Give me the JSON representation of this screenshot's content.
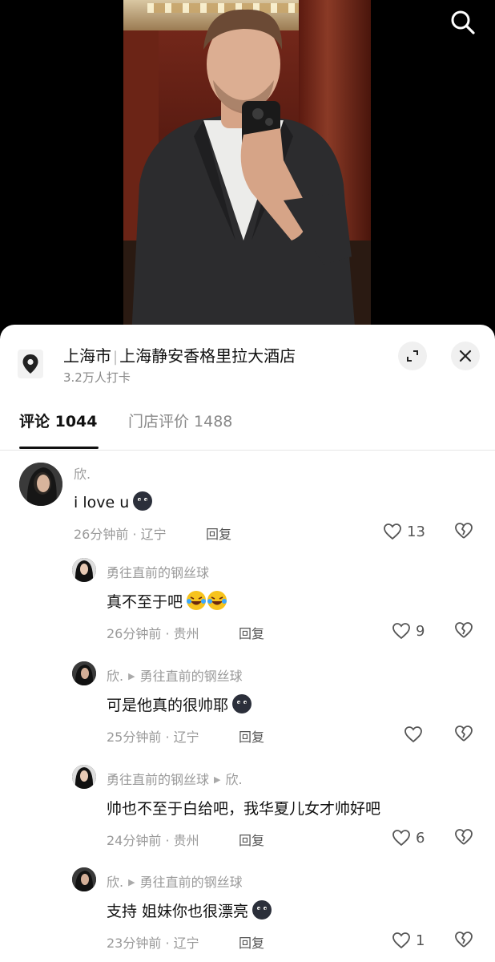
{
  "location": {
    "city": "上海市",
    "separator": "|",
    "place": "上海静安香格里拉大酒店",
    "checkins": "3.2万人打卡"
  },
  "tabs": [
    {
      "label": "评论 1044",
      "active": true
    },
    {
      "label": "门店评价 1488",
      "active": false
    }
  ],
  "comments": [
    {
      "user": "欣.",
      "text": "i love u",
      "time": "26分钟前 · 辽宁",
      "reply": "回复",
      "likes": "13"
    },
    {
      "user": "勇往直前的钢丝球",
      "text": "真不至于吧",
      "time": "26分钟前 · 贵州",
      "reply": "回复",
      "likes": "9"
    },
    {
      "user": "欣.",
      "reply_to": "勇往直前的钢丝球",
      "text": "可是他真的很帅耶",
      "time": "25分钟前 · 辽宁",
      "reply": "回复",
      "likes": ""
    },
    {
      "user": "勇往直前的钢丝球",
      "reply_to": "欣.",
      "text": "帅也不至于白给吧，我华夏儿女才帅好吧",
      "time": "24分钟前 · 贵州",
      "reply": "回复",
      "likes": "6"
    },
    {
      "user": "欣.",
      "reply_to": "勇往直前的钢丝球",
      "text": "支持 姐妹你也很漂亮",
      "time": "23分钟前 · 辽宁",
      "reply": "回复",
      "likes": "1"
    }
  ],
  "icons": {
    "search": "search-icon",
    "pin": "location-pin-icon",
    "expand": "expand-icon",
    "close": "close-icon",
    "like": "heart-icon",
    "dislike": "broken-heart-icon"
  },
  "colors": {
    "text": "#111111",
    "muted": "#999999",
    "sheet": "#ffffff",
    "background": "#000000"
  }
}
